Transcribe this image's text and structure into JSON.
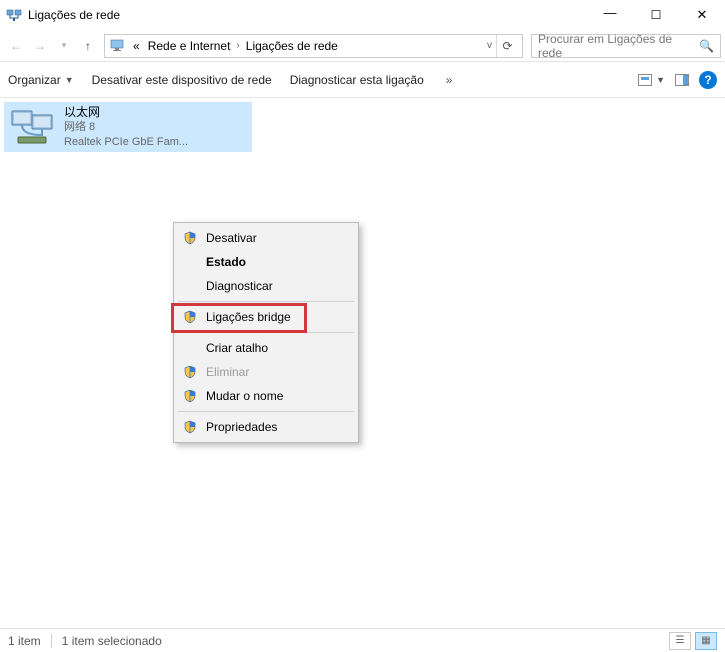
{
  "titlebar": {
    "title": "Ligações de rede"
  },
  "address": {
    "prefix": "«",
    "crumb1": "Rede e Internet",
    "crumb2": "Ligações de rede"
  },
  "search": {
    "placeholder": "Procurar em Ligações de rede"
  },
  "cmdbar": {
    "organize": "Organizar",
    "disable": "Desativar este dispositivo de rede",
    "diagnose": "Diagnosticar esta ligação",
    "more": "»"
  },
  "adapter": {
    "name": "以太网",
    "network": "网络 8",
    "device": "Realtek PCIe GbE Fam..."
  },
  "context_menu": {
    "items": [
      {
        "label": "Desativar",
        "shield": true
      },
      {
        "label": "Estado",
        "bold": true
      },
      {
        "label": "Diagnosticar"
      }
    ],
    "items2": [
      {
        "label": "Ligações bridge",
        "shield": true
      }
    ],
    "items3": [
      {
        "label": "Criar atalho"
      },
      {
        "label": "Eliminar",
        "shield": true,
        "disabled": true
      },
      {
        "label": "Mudar o nome",
        "shield": true
      }
    ],
    "items4": [
      {
        "label": "Propriedades",
        "shield": true
      }
    ]
  },
  "statusbar": {
    "count": "1 item",
    "selected": "1 item selecionado"
  }
}
